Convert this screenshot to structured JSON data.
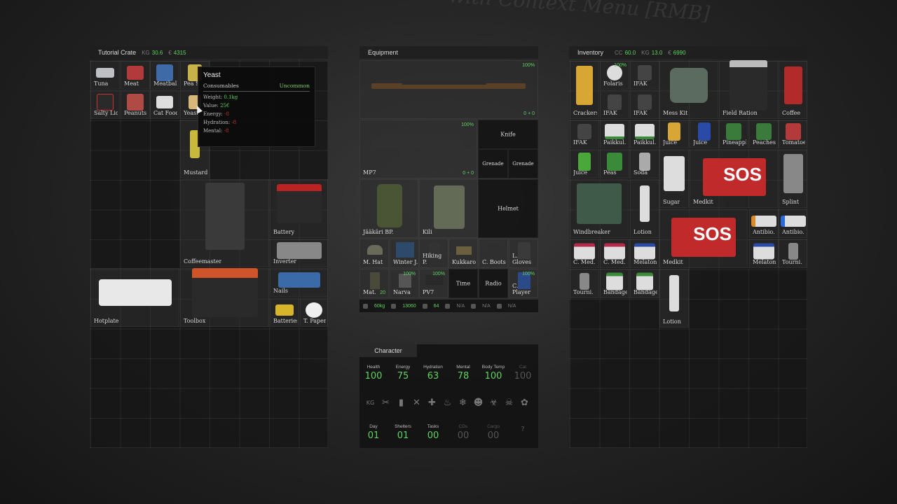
{
  "background_text": "with Context Menu [RMB]",
  "crate": {
    "title": "Tutorial Crate",
    "kg_icon": "KG",
    "kg": "30.6",
    "money_icon": "€",
    "money": "4315",
    "items": [
      "Tuna",
      "Meat",
      "Meatballs",
      "Pea S",
      "Salty Liq.",
      "Peanuts",
      "Cat Food",
      "Yeast",
      "Mustard",
      "Battery",
      "Coffeemaster",
      "Inverter",
      "Nails",
      "Hotplate",
      "Toolbox",
      "Batteries",
      "T. Paper"
    ]
  },
  "tooltip": {
    "name": "Yeast",
    "category": "Consumables",
    "rarity": "Uncommon",
    "weight_label": "Weight:",
    "weight": "0.1kg",
    "value_label": "Value:",
    "value": "25€",
    "energy_label": "Energy:",
    "energy": "-8",
    "hydration_label": "Hydration:",
    "hydration": "-8",
    "mental_label": "Mental:",
    "mental": "-8"
  },
  "equipment": {
    "title": "Equipment",
    "rifle_pct": "100%",
    "rifle_ammo": "0 + 0",
    "mp7_label": "MP7",
    "mp7_pct": "100%",
    "mp7_ammo": "0 + 0",
    "knife": "Knife",
    "grenade1": "Grenade",
    "grenade2": "Grenade",
    "backpack": "Jääkäri BP.",
    "vest": "Kili",
    "helmet": "Helmet",
    "row1": [
      "M. Hat",
      "Winter J.",
      "Hiking P.",
      "Kukkaro",
      "C. Boots",
      "L. Gloves"
    ],
    "mat": "Mat.",
    "mat_count": "20",
    "narva": "Narva",
    "narva_pct": "100%",
    "pv7": "PV7",
    "pv7_pct": "100%",
    "time": "Time",
    "radio": "Radio",
    "cplayer": "C. Player",
    "cplayer_pct": "100%",
    "bar": {
      "weight": "60kg",
      "money": "13060",
      "count": "64",
      "na1": "N/A",
      "na2": "N/A",
      "na3": "N/A"
    }
  },
  "character": {
    "title": "Character",
    "stats": [
      {
        "name": "Health",
        "value": "100"
      },
      {
        "name": "Energy",
        "value": "75"
      },
      {
        "name": "Hydration",
        "value": "63"
      },
      {
        "name": "Mental",
        "value": "78"
      },
      {
        "name": "Body Temp",
        "value": "100"
      },
      {
        "name": "Cat",
        "value": "100"
      }
    ],
    "status_icons": [
      "KG",
      "✂",
      "▮",
      "✕",
      "✚",
      "♨",
      "❄",
      "☻",
      "☣",
      "☠",
      "✿"
    ],
    "days": [
      {
        "name": "Day",
        "value": "01"
      },
      {
        "name": "Shelters",
        "value": "01"
      },
      {
        "name": "Tasks",
        "value": "00"
      },
      {
        "name": "CDs",
        "value": "00"
      },
      {
        "name": "Cargo",
        "value": "00"
      },
      {
        "name": "",
        "value": "?"
      }
    ]
  },
  "inventory": {
    "title": "Inventory",
    "cc_icon": "CC",
    "cc": "60.0",
    "kg_icon": "KG",
    "kg": "13.0",
    "money_icon": "€",
    "money": "6990",
    "items": [
      "Crackers",
      "Folaris",
      "IFAK",
      "IFAK",
      "IFAK",
      "Mess Kit",
      "Field Ration",
      "Coffee",
      "IFAK",
      "Paikkul.",
      "Paikkul.",
      "Juice",
      "Juice",
      "Pineapple",
      "Peaches",
      "Tomatoes",
      "Juice",
      "Peas",
      "Soda",
      "Sugar",
      "Medkit",
      "Splint",
      "Windbreaker",
      "Lotion",
      "Antibio.",
      "Antibio.",
      "C. Med.",
      "C. Med.",
      "Melaton.",
      "Medkit",
      "Melaton.",
      "Tourni.",
      "Tourni.",
      "Bandage",
      "Bandage",
      "Lotion"
    ],
    "folaris_pct": "100%",
    "sos_text": "SOS",
    "medkit_sub": "MEDKIT"
  }
}
